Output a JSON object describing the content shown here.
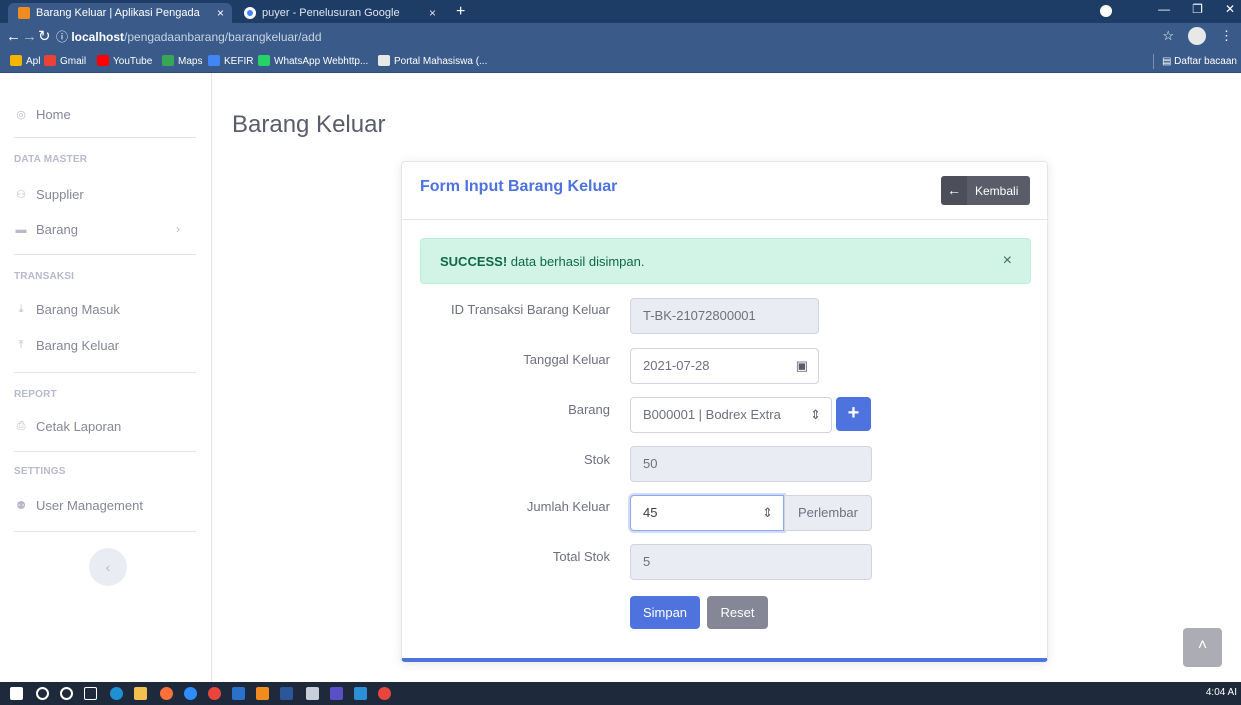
{
  "browser": {
    "tabs": [
      {
        "title": "Barang Keluar | Aplikasi Pengada",
        "close": "×"
      },
      {
        "title": "puyer - Penelusuran Google",
        "close": "×"
      }
    ],
    "new_tab": "+",
    "url_host": "localhost",
    "url_path": "/pengadaanbarang/barangkeluar/add",
    "bookmarks": [
      {
        "label": "Apl",
        "color": "#f4b400"
      },
      {
        "label": "Gmail",
        "color": "#ea4335"
      },
      {
        "label": "YouTube",
        "color": "#ff0000"
      },
      {
        "label": "Maps",
        "color": "#34a853"
      },
      {
        "label": "KEFIR",
        "color": "#4285f4"
      },
      {
        "label": "WhatsApp Webhttp...",
        "color": "#25d366"
      },
      {
        "label": "Portal Mahasiswa (...",
        "color": "#e8e8e8"
      }
    ],
    "reading_list": "Daftar bacaan"
  },
  "sidebar": {
    "home": "Home",
    "sections": {
      "data_master": "DATA MASTER",
      "transaksi": "TRANSAKSI",
      "report": "REPORT",
      "settings": "SETTINGS"
    },
    "items": {
      "supplier": "Supplier",
      "barang": "Barang",
      "barang_masuk": "Barang Masuk",
      "barang_keluar": "Barang Keluar",
      "cetak_laporan": "Cetak Laporan",
      "user_management": "User Management"
    },
    "toggle": "‹"
  },
  "page": {
    "title": "Barang Keluar",
    "card_title": "Form Input Barang Keluar",
    "back_label": "Kembali",
    "alert_strong": "SUCCESS!",
    "alert_text": " data berhasil disimpan.",
    "alert_close": "×",
    "form": {
      "id_label": "ID Transaksi Barang Keluar",
      "id_value": "T-BK-21072800001",
      "tanggal_label": "Tanggal Keluar",
      "tanggal_value": "2021-07-28",
      "barang_label": "Barang",
      "barang_value": "B000001 | Bodrex Extra",
      "stok_label": "Stok",
      "stok_value": "50",
      "jumlah_label": "Jumlah Keluar",
      "jumlah_value": "45",
      "jumlah_unit": "Perlembar",
      "total_label": "Total Stok",
      "total_value": "5"
    },
    "simpan": "Simpan",
    "reset": "Reset"
  },
  "taskbar": {
    "clock": "4:04 AI"
  },
  "colors": {
    "primary": "#4e73df",
    "secondary": "#858796",
    "success_bg": "#d1f4e6",
    "chrome": "#3a5b8a"
  }
}
